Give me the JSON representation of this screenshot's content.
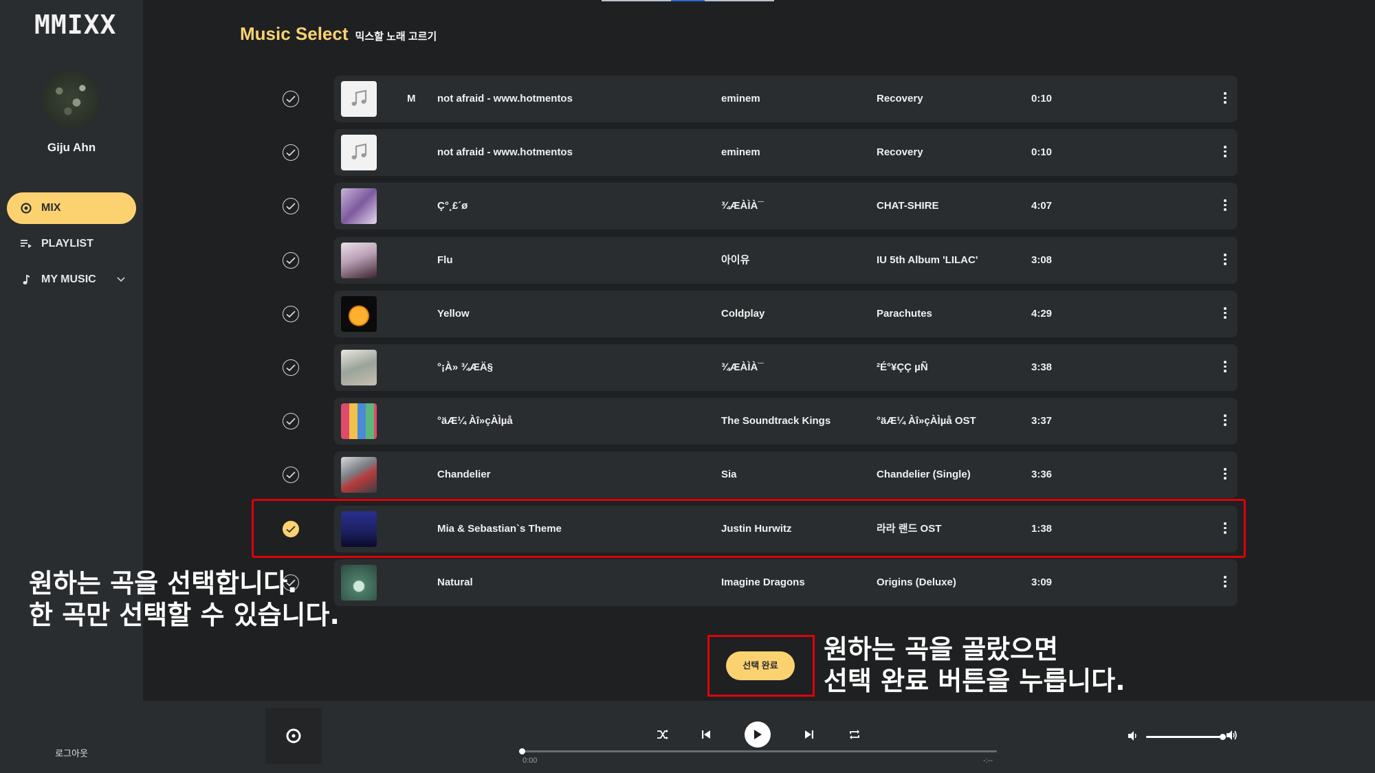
{
  "app": {
    "logo": "MMIXX"
  },
  "user": {
    "name": "Giju Ahn",
    "logout_label": "로그아웃"
  },
  "nav": [
    {
      "label": "MIX",
      "icon": "radio-button-icon",
      "active": true
    },
    {
      "label": "PLAYLIST",
      "icon": "playlist-icon",
      "active": false
    },
    {
      "label": "MY MUSIC",
      "icon": "music-note-icon",
      "active": false
    }
  ],
  "page": {
    "title": "Music Select",
    "subtitle": "믹스할 노래 고르기"
  },
  "songs": [
    {
      "marker": "M",
      "title": "not afraid - www.hotmentos",
      "artist": "eminem",
      "album": "Recovery",
      "duration": "0:10",
      "checked": false,
      "thumb": "default"
    },
    {
      "marker": "",
      "title": "not afraid - www.hotmentos",
      "artist": "eminem",
      "album": "Recovery",
      "duration": "0:10",
      "checked": false,
      "thumb": "default"
    },
    {
      "marker": "",
      "title": "Ç°¸£´ø",
      "artist": "¾ÆÀÌÀ¯",
      "album": "CHAT-SHIRE",
      "duration": "4:07",
      "checked": false,
      "thumb": "chatshire"
    },
    {
      "marker": "",
      "title": "Flu",
      "artist": "아이유",
      "album": "IU 5th Album 'LILAC'",
      "duration": "3:08",
      "checked": false,
      "thumb": "lilac"
    },
    {
      "marker": "",
      "title": "Yellow",
      "artist": "Coldplay",
      "album": "Parachutes",
      "duration": "4:29",
      "checked": false,
      "thumb": "parachutes"
    },
    {
      "marker": "",
      "title": "°¡À» ¾ÆÄ§",
      "artist": "¾ÆÀÌÀ¯",
      "album": "²É°¥ÇÇ µÑ",
      "duration": "3:38",
      "checked": false,
      "thumb": "flowerbookmark"
    },
    {
      "marker": "",
      "title": "°äÆ¼ Àî»çÀÌµå",
      "artist": "The Soundtrack Kings",
      "album": "°äÆ¼ Àî»çÀÌµå OST",
      "duration": "3:37",
      "checked": false,
      "thumb": "ost-grid"
    },
    {
      "marker": "",
      "title": "Chandelier",
      "artist": "Sia",
      "album": "Chandelier (Single)",
      "duration": "3:36",
      "checked": false,
      "thumb": "chandelier"
    },
    {
      "marker": "",
      "title": "Mia & Sebastian`s Theme",
      "artist": "Justin Hurwitz",
      "album": "라라 랜드 OST",
      "duration": "1:38",
      "checked": true,
      "thumb": "lalaland"
    },
    {
      "marker": "",
      "title": "Natural",
      "artist": "Imagine Dragons",
      "album": "Origins (Deluxe)",
      "duration": "3:09",
      "checked": false,
      "thumb": "origins"
    }
  ],
  "select_button": {
    "label": "선택 완료"
  },
  "annotations": {
    "left": [
      "원하는 곡을 선택합니다.",
      "한 곡만 선택할 수 있습니다."
    ],
    "right": [
      "원하는 곡을 골랐으면",
      "선택 완료 버튼을 누릅니다."
    ]
  },
  "player": {
    "current_time": "0:00",
    "end_time": "-:--",
    "progress": 0,
    "volume": 1.0
  },
  "colors": {
    "accent": "#fcd271",
    "background": "#1e2021",
    "panel": "#2a2d30",
    "highlight_box": "#e0000a"
  }
}
